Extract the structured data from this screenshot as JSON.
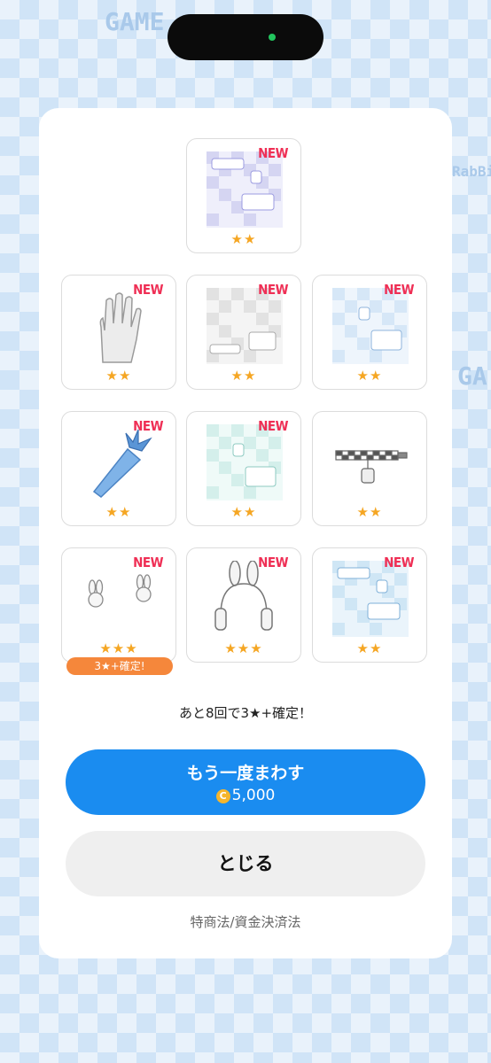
{
  "background": {
    "text_left": "GAME",
    "text_right": "GA",
    "text_rabbit": "RabBi"
  },
  "results": [
    {
      "new_label": "NEW",
      "stars": "★★",
      "icon": "wallpaper-pattern-lavender-icon"
    },
    {
      "new_label": "NEW",
      "stars": "★★",
      "icon": "white-glove-icon"
    },
    {
      "new_label": "NEW",
      "stars": "★★",
      "icon": "wallpaper-pattern-gray-icon"
    },
    {
      "new_label": "NEW",
      "stars": "★★",
      "icon": "wallpaper-pattern-lightblue-icon"
    },
    {
      "new_label": "NEW",
      "stars": "★★",
      "icon": "blue-carrot-icon"
    },
    {
      "new_label": "NEW",
      "stars": "★★",
      "icon": "wallpaper-pattern-mint-icon"
    },
    {
      "new_label": "",
      "stars": "★★",
      "icon": "checkered-choker-icon"
    },
    {
      "new_label": "NEW",
      "stars": "★★★",
      "icon": "bunny-earrings-icon",
      "badge": "3★+確定!"
    },
    {
      "new_label": "NEW",
      "stars": "★★★",
      "icon": "bunny-headphones-icon"
    },
    {
      "new_label": "NEW",
      "stars": "★★",
      "icon": "wallpaper-pattern-blue-icon"
    }
  ],
  "notice": "あと8回で3★+確定！",
  "spin_again": {
    "label": "もう一度まわす",
    "coin_symbol": "C",
    "price": "5,000"
  },
  "close_label": "とじる",
  "legal_link": "特商法/資金決済法",
  "colors": {
    "accent": "#1a8cf0",
    "new": "#ef2f55",
    "star": "#f5a623",
    "badge": "#f5873b"
  }
}
